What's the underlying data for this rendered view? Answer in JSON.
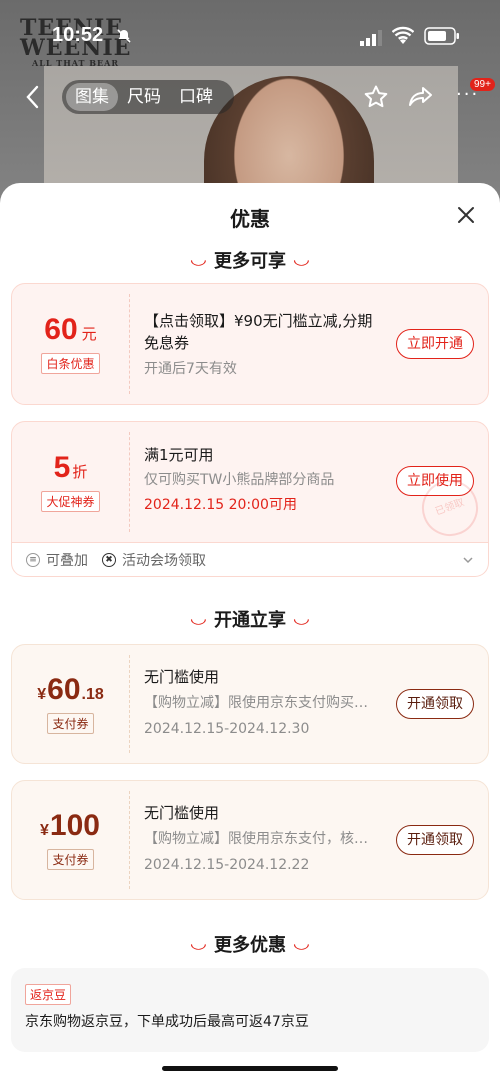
{
  "status_bar": {
    "time": "10:52"
  },
  "background": {
    "brand_logo": [
      "TEENIE",
      "WEENIE",
      "ALL THAT BEAR"
    ],
    "tabs": [
      "图集",
      "尺码",
      "口碑"
    ],
    "active_tab": "图集",
    "message_badge": "99+",
    "icons": [
      "back-arrow-icon",
      "star-icon",
      "share-icon",
      "more-icon"
    ]
  },
  "sheet": {
    "title": "优惠",
    "close_icon": "close-icon",
    "sections": {
      "more_available": "更多可享",
      "open_enjoy": "开通立享",
      "more_offers": "更多优惠"
    },
    "coupons_more": [
      {
        "amount": "60",
        "unit": "元",
        "tag": "白条优惠",
        "title": "【点击领取】¥90无门槛立减,分期免息券",
        "sub": "开通后7天有效",
        "button": "立即开通"
      },
      {
        "amount": "5",
        "unit": "折",
        "tag": "大促神券",
        "title": "满1元可用",
        "sub": "仅可购买TW小熊品牌部分商品",
        "date": "2024.12.15 20:00可用",
        "button": "立即使用",
        "stamp": "已领取",
        "extras": [
          "可叠加",
          "活动会场领取"
        ]
      }
    ],
    "coupons_open": [
      {
        "currency": "¥",
        "amount": "60",
        "decimal": ".18",
        "tag": "支付券",
        "title": "无门槛使用",
        "sub": "【购物立减】限使用京东支付购买…",
        "date": "2024.12.15-2024.12.30",
        "button": "开通领取"
      },
      {
        "currency": "¥",
        "amount": "100",
        "decimal": "",
        "tag": "支付券",
        "title": "无门槛使用",
        "sub": "【购物立减】限使用京东支付，核…",
        "date": "2024.12.15-2024.12.22",
        "button": "开通领取"
      }
    ],
    "more_offer": {
      "tag": "返京豆",
      "text": "京东购物返京豆，下单成功后最高可返47京豆"
    }
  },
  "colors": {
    "accent": "#e2231a",
    "brown": "#8a2a12",
    "coupon_bg": "#fef3f1"
  }
}
